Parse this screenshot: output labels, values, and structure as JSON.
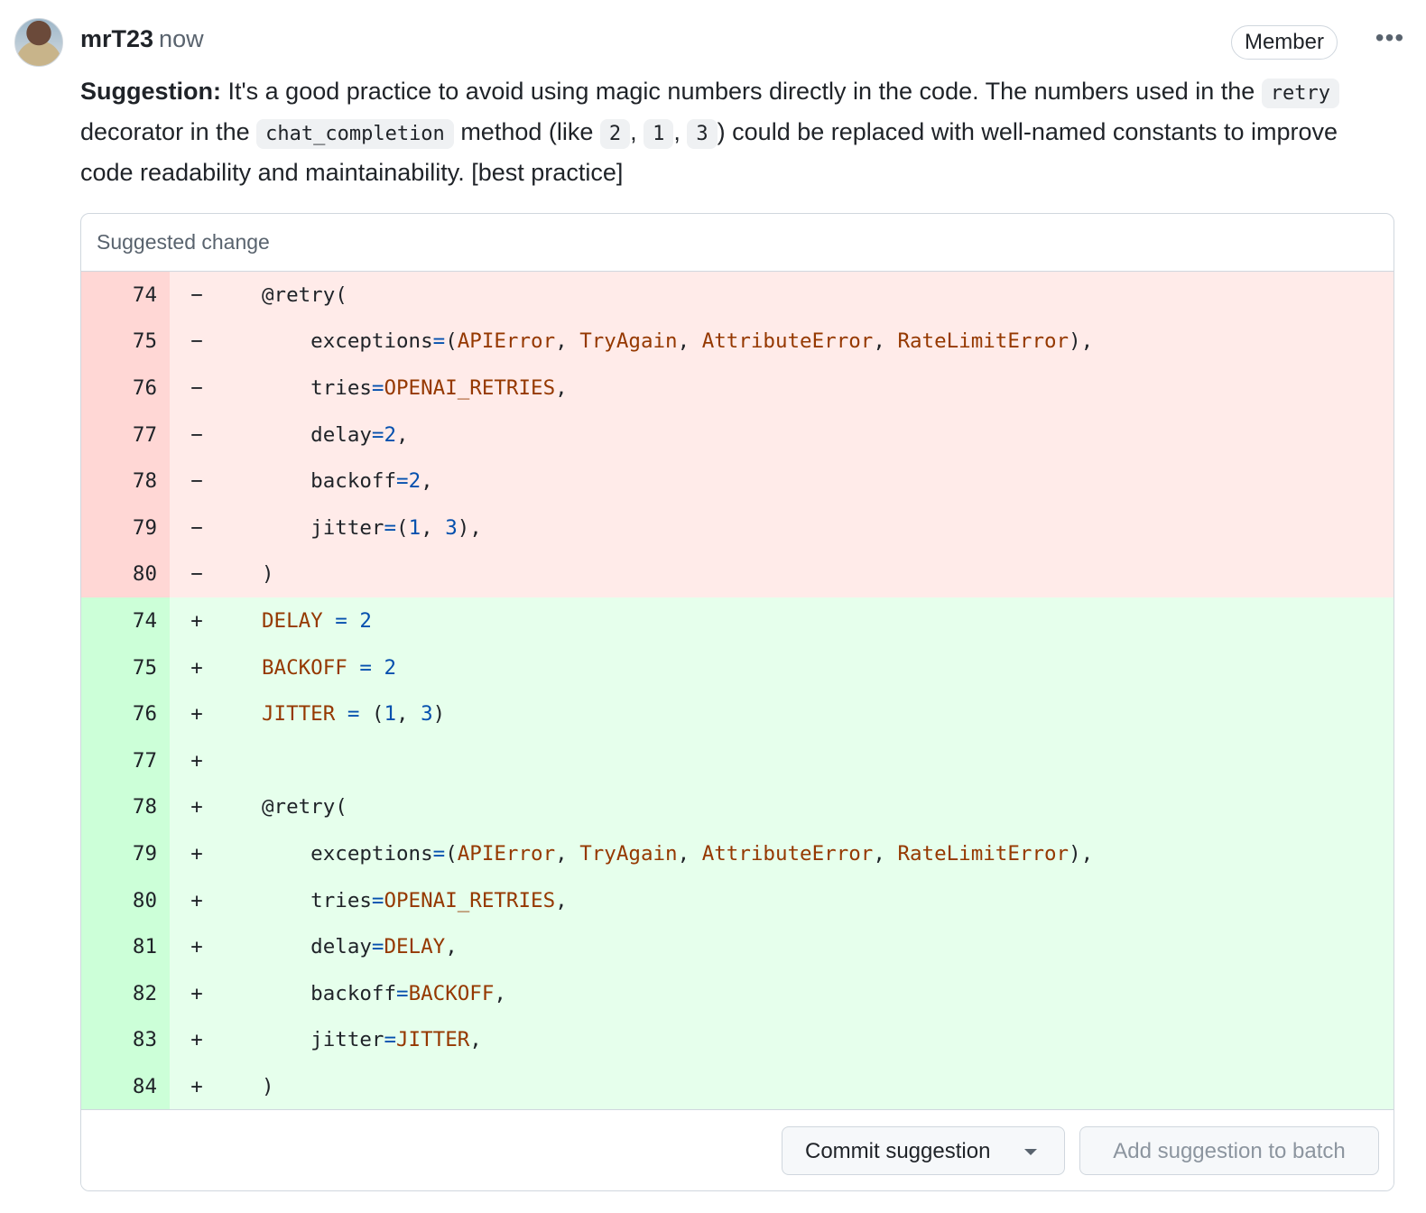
{
  "author": "mrT23",
  "time": "now",
  "badge": "Member",
  "more_icon": "kebab-horizontal-icon",
  "comment": {
    "label": "Suggestion:",
    "t1": " It's a good practice to avoid using magic numbers directly in the code. The numbers used in the ",
    "code1": "retry",
    "t2": " decorator in the ",
    "code2": "chat_completion",
    "t3": " method (like ",
    "code3": "2",
    "t4": ", ",
    "code4": "1",
    "t5": ", ",
    "code5": "3",
    "t6": ") could be replaced with well-named constants to improve code readability and maintainability. [best practice]"
  },
  "suggestion": {
    "header": "Suggested change",
    "deleted": [
      {
        "ln": "74",
        "sign": "−",
        "code": "@retry("
      },
      {
        "ln": "75",
        "sign": "−",
        "code": "    exceptions=(APIError, TryAgain, AttributeError, RateLimitError),"
      },
      {
        "ln": "76",
        "sign": "−",
        "code": "    tries=OPENAI_RETRIES,"
      },
      {
        "ln": "77",
        "sign": "−",
        "code": "    delay=2,"
      },
      {
        "ln": "78",
        "sign": "−",
        "code": "    backoff=2,"
      },
      {
        "ln": "79",
        "sign": "−",
        "code": "    jitter=(1, 3),"
      },
      {
        "ln": "80",
        "sign": "−",
        "code": ")"
      }
    ],
    "added": [
      {
        "ln": "74",
        "sign": "+",
        "code": "DELAY = 2"
      },
      {
        "ln": "75",
        "sign": "+",
        "code": "BACKOFF = 2"
      },
      {
        "ln": "76",
        "sign": "+",
        "code": "JITTER = (1, 3)"
      },
      {
        "ln": "77",
        "sign": "+",
        "code": ""
      },
      {
        "ln": "78",
        "sign": "+",
        "code": "@retry("
      },
      {
        "ln": "79",
        "sign": "+",
        "code": "    exceptions=(APIError, TryAgain, AttributeError, RateLimitError),"
      },
      {
        "ln": "80",
        "sign": "+",
        "code": "    tries=OPENAI_RETRIES,"
      },
      {
        "ln": "81",
        "sign": "+",
        "code": "    delay=DELAY,"
      },
      {
        "ln": "82",
        "sign": "+",
        "code": "    backoff=BACKOFF,"
      },
      {
        "ln": "83",
        "sign": "+",
        "code": "    jitter=JITTER,"
      },
      {
        "ln": "84",
        "sign": "+",
        "code": ")"
      }
    ],
    "commit_button": "Commit suggestion",
    "batch_button": "Add suggestion to batch"
  }
}
